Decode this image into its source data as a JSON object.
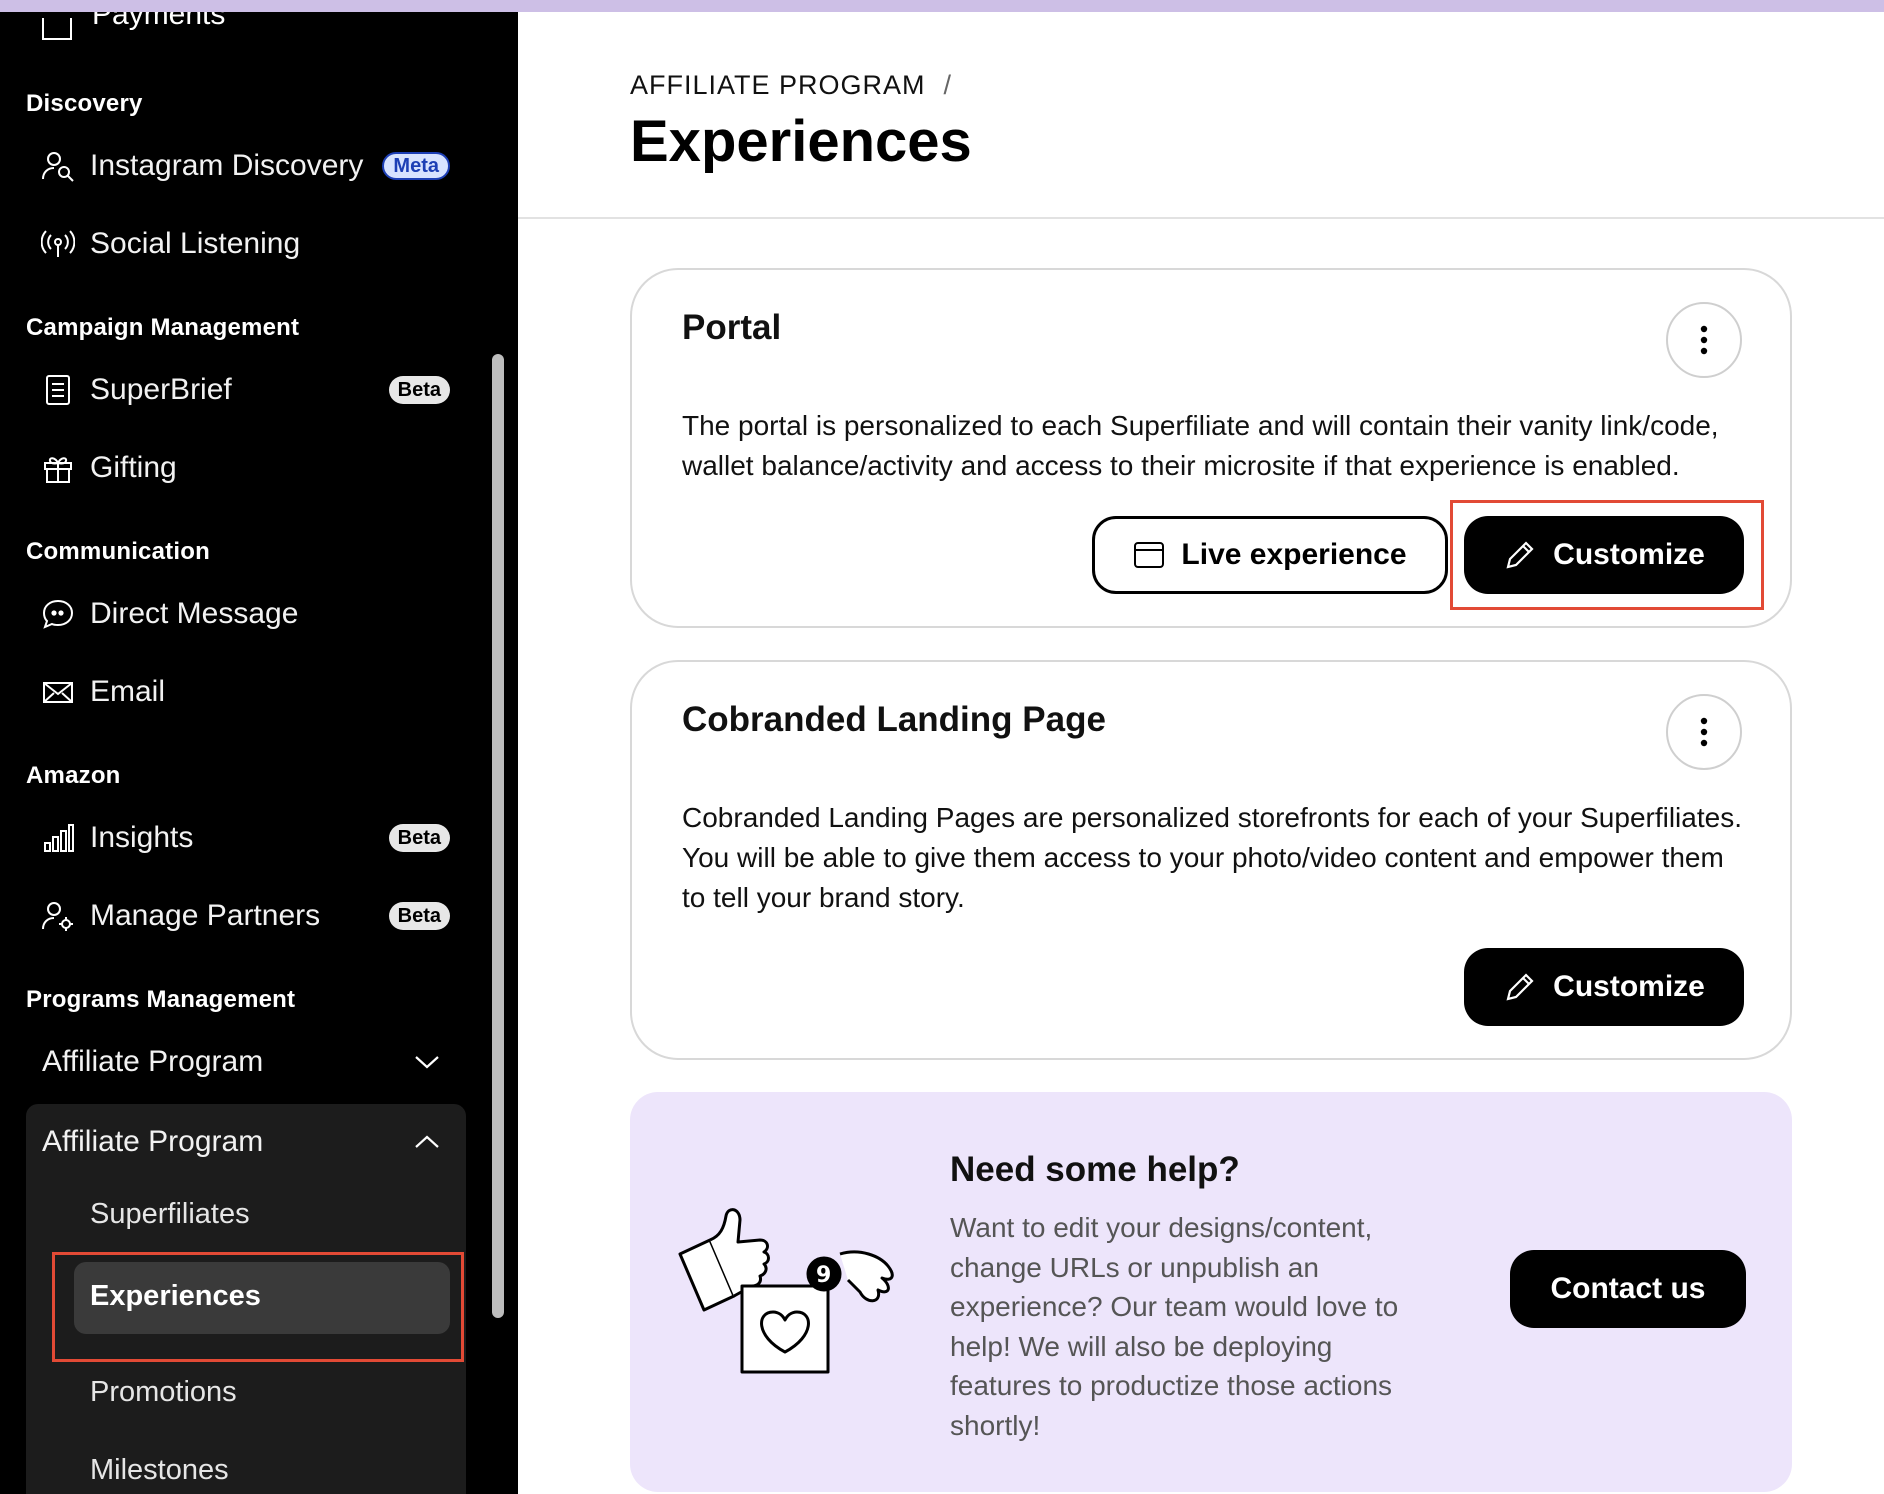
{
  "sidebar": {
    "partial_item": "Payments",
    "sections": {
      "discovery": "Discovery",
      "campaign": "Campaign Management",
      "communication": "Communication",
      "amazon": "Amazon",
      "programs": "Programs Management"
    },
    "items": {
      "instagram_discovery": {
        "label": "Instagram Discovery",
        "badge": "Meta"
      },
      "social_listening": {
        "label": "Social Listening"
      },
      "superbrief": {
        "label": "SuperBrief",
        "badge": "Beta"
      },
      "gifting": {
        "label": "Gifting"
      },
      "direct_message": {
        "label": "Direct Message"
      },
      "email": {
        "label": "Email"
      },
      "insights": {
        "label": "Insights",
        "badge": "Beta"
      },
      "manage_partners": {
        "label": "Manage Partners",
        "badge": "Beta"
      }
    },
    "affiliate_collapsed": "Affiliate Program",
    "affiliate_expanded": "Affiliate Program",
    "sub_items": {
      "superfiliates": "Superfiliates",
      "experiences": "Experiences",
      "promotions": "Promotions",
      "milestones": "Milestones"
    }
  },
  "header": {
    "breadcrumb": "AFFILIATE PROGRAM",
    "breadcrumb_sep": "/",
    "title": "Experiences"
  },
  "portal": {
    "title": "Portal",
    "description": "The portal is personalized to each Superfiliate and will contain their vanity link/code, wallet balance/activity and access to their microsite if that experience is enabled.",
    "live_label": "Live experience",
    "customize_label": "Customize"
  },
  "landing": {
    "title": "Cobranded Landing Page",
    "description": "Cobranded Landing Pages are personalized storefronts for each of your Superfiliates. You will be able to give them access to your photo/video content and empower them to tell your brand story.",
    "customize_label": "Customize"
  },
  "help": {
    "title": "Need some help?",
    "text": "Want to edit your designs/content, change URLs or unpublish an experience? Our team would love to help! We will also be deploying features to productize those actions shortly!",
    "contact_label": "Contact us"
  },
  "colors": {
    "accent_highlight": "#e24a35",
    "help_bg": "#ede5fb",
    "sidebar_bg": "#000000"
  }
}
